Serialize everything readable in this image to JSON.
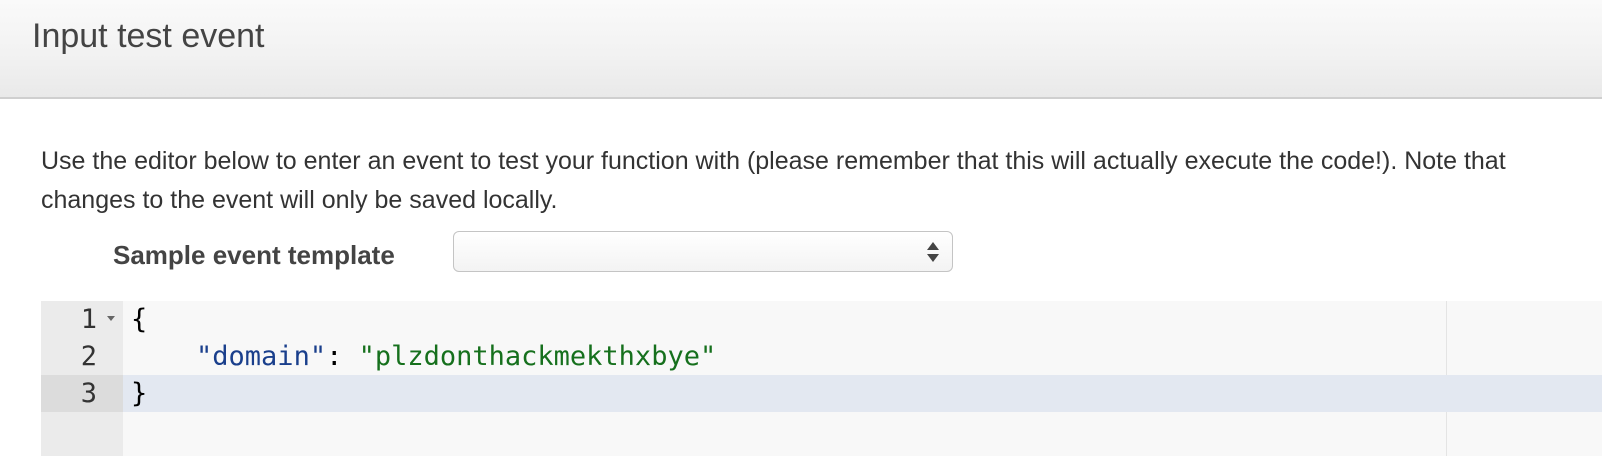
{
  "header": {
    "title": "Input test event"
  },
  "description": {
    "text": "Use the editor below to enter an event to test your function with (please remember that this will actually execute the code!). Note that changes to the event will only be saved locally."
  },
  "template": {
    "label": "Sample event template",
    "selected_value": ""
  },
  "editor": {
    "lines": [
      {
        "number": "1",
        "open_brace": "{"
      },
      {
        "number": "2",
        "key": "\"domain\"",
        "colon": ": ",
        "value": "\"plzdonthackmekthxbye\""
      },
      {
        "number": "3",
        "close_brace": "}"
      }
    ],
    "active_line": 3
  },
  "colors": {
    "json_key": "#1a3f8c",
    "json_string": "#16701d",
    "active_line_bg": "#e3e8f1"
  }
}
